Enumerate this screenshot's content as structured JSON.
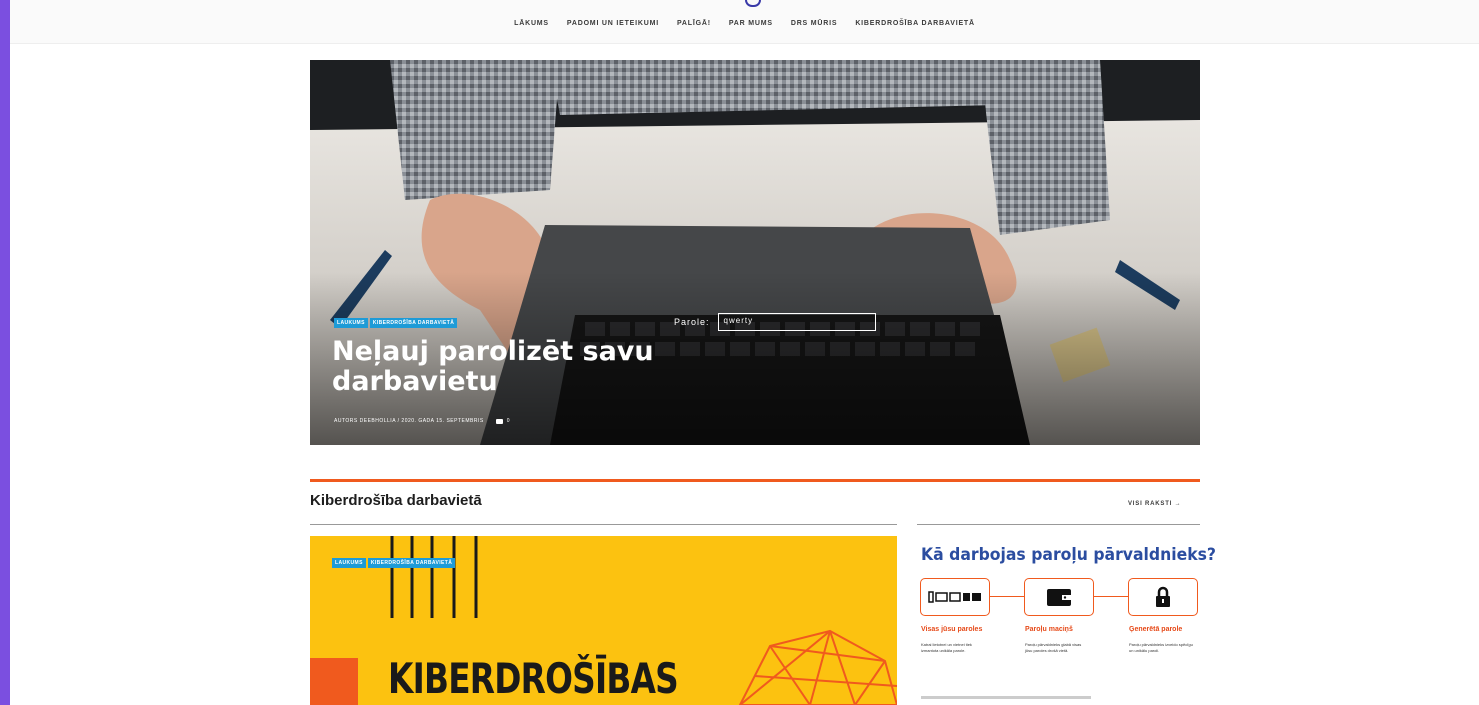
{
  "nav": {
    "items": [
      "LĀKUMS",
      "PADOMI UN IETEIKUMI",
      "PALĪGĀ!",
      "PAR MUMS",
      "DRS MŪRIS",
      "KIBERDROŠĪBA DARBAVIETĀ"
    ]
  },
  "hero": {
    "badges": [
      "LAUKUMS",
      "KIBERDROŠĪBA DARBAVIETĀ"
    ],
    "title": "Neļauj parolizēt savu darbavietu",
    "meta": "AUTORS DEEBHOLLIA  /  2020. GADA 15. SEPTEMBRIS",
    "comments": "0",
    "password_label": "Parole:",
    "password_value": "qwerty"
  },
  "section": {
    "title": "Kiberdrošība darbavietā",
    "view_all": "VISI RAKSTI →"
  },
  "card_main": {
    "badges": [
      "LAUKUMS",
      "KIBERDROŠĪBA DARBAVIETĀ"
    ],
    "title": "KIBERDROŠĪBAS"
  },
  "side_card": {
    "title": "Kā darbojas paroļu pārvaldnieks?",
    "labels": [
      "Visas jūsu paroles",
      "Paroļu maciņš",
      "Ģenerētā parole"
    ],
    "texts": [
      "Katrai lietotnei un vietnei tiek izmantota unikāla parole.",
      "Paroļu pārvaldnieks glabā visas jūsu paroles drošā vietā.",
      "Paroļu pārvaldnieks izveido spēcīgu un unikālu paroli."
    ]
  },
  "colors": {
    "accent_orange": "#f05a1e",
    "badge_blue": "#1e9bd7",
    "card_yellow": "#fcc210",
    "side_title_blue": "#2b4da0",
    "left_strip": "#7b4fe0"
  }
}
